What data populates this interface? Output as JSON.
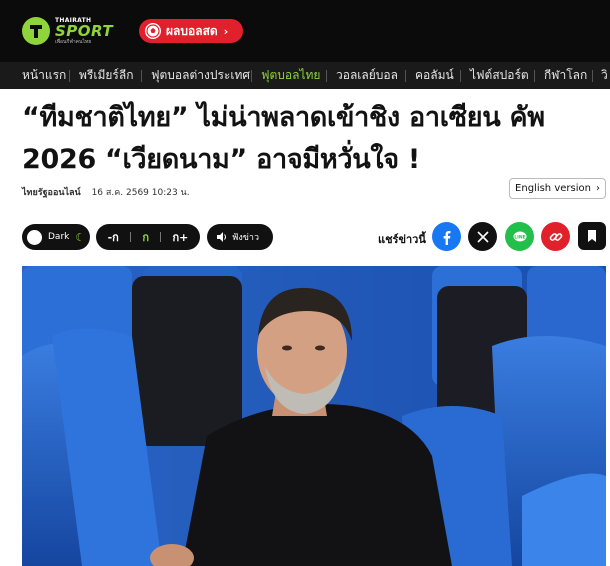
{
  "header": {
    "logo": {
      "top_text": "THAIRATH",
      "main_text": "SPORT",
      "tagline": "เพื่อนกีฬาคนไทย"
    },
    "live_button": "ผลบอลสด"
  },
  "nav": {
    "items": [
      {
        "label": "หน้าแรก",
        "active": false
      },
      {
        "label": "พรีเมียร์ลีก",
        "active": false
      },
      {
        "label": "ฟุตบอลต่างประเทศ",
        "active": false
      },
      {
        "label": "ฟุตบอลไทย",
        "active": true
      },
      {
        "label": "วอลเลย์บอล",
        "active": false
      },
      {
        "label": "คอลัมน์",
        "active": false
      },
      {
        "label": "ไฟต์สปอร์ต",
        "active": false
      },
      {
        "label": "กีฬาโลก",
        "active": false
      },
      {
        "label": "วิ",
        "active": false
      }
    ],
    "active_color": "#8fd43a"
  },
  "article": {
    "headline_line1": "“ทีมชาติไทย” ไม่น่าพลาดเข้าชิง อาเซียน คัพ",
    "headline_line2": "2026 “เวียดนาม” อาจมีหวั่นใจ !",
    "source": "ไทยรัฐออนไลน์",
    "date": "16 ส.ค. 2569 10:23 น.",
    "english_button": "English version"
  },
  "controls": {
    "dark_label": "Dark",
    "size_small": "-ก",
    "size_normal": "ก",
    "size_large": "ก+",
    "listen_label": "ฟังข่าว"
  },
  "share": {
    "label": "แชร์ข่าวนี้",
    "buttons": [
      "facebook-icon",
      "x-icon",
      "line-icon",
      "copy-link-icon",
      "bookmark-icon"
    ]
  },
  "colors": {
    "brand_green": "#8fd43a",
    "live_red": "#e0202a",
    "facebook": "#1877f2",
    "line": "#22c04b"
  }
}
